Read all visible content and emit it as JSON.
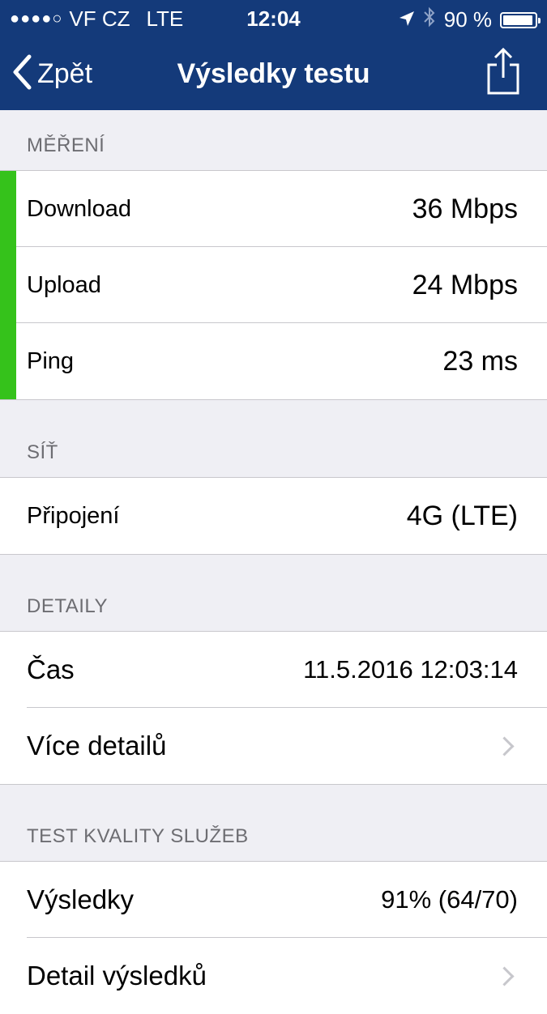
{
  "status_bar": {
    "signal_dots": "●●●●○",
    "carrier": "VF CZ",
    "network": "LTE",
    "time": "12:04",
    "battery": "90 %",
    "icons": [
      "location-arrow-icon",
      "bluetooth-icon",
      "battery-icon"
    ]
  },
  "nav": {
    "back_label": "Zpět",
    "title": "Výsledky testu",
    "share_icon": "share-icon"
  },
  "colors": {
    "nav_bg": "#143a7a",
    "good_indicator": "#35c21b",
    "page_bg": "#efeff4",
    "section_header": "#6d6d72"
  },
  "sections": {
    "measurement": {
      "header": "MĚŘENÍ",
      "rows": [
        {
          "label": "Download",
          "value": "36 Mbps",
          "status": "good"
        },
        {
          "label": "Upload",
          "value": "24 Mbps",
          "status": "good"
        },
        {
          "label": "Ping",
          "value": "23 ms",
          "status": "good"
        }
      ]
    },
    "network": {
      "header": "SÍŤ",
      "rows": [
        {
          "label": "Připojení",
          "value": "4G (LTE)"
        }
      ]
    },
    "details": {
      "header": "DETAILY",
      "rows": [
        {
          "label": "Čas",
          "value": "11.5.2016 12:03:14"
        },
        {
          "label": "Více detailů"
        }
      ]
    },
    "qos": {
      "header": "TEST KVALITY SLUŽEB",
      "rows": [
        {
          "label": "Výsledky",
          "value": "91% (64/70)"
        },
        {
          "label": "Detail výsledků"
        }
      ]
    }
  }
}
